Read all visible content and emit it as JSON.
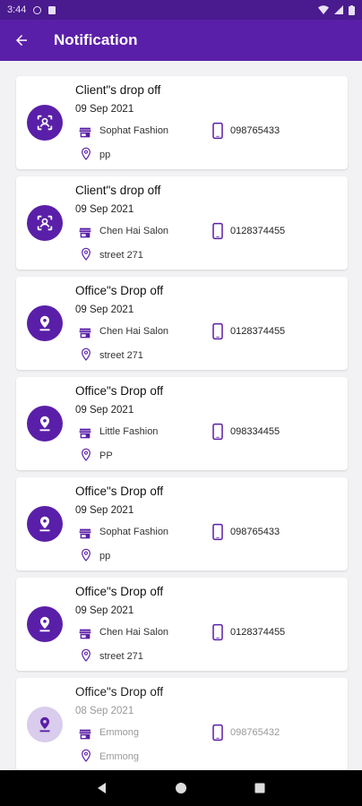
{
  "status_bar": {
    "time": "3:44"
  },
  "header": {
    "title": "Notification"
  },
  "colors": {
    "primary": "#5a1fa8",
    "status_bar": "#4a1a8f",
    "faded_avatar": "#d9ccec"
  },
  "icons": {
    "back": "arrow-left",
    "client": "face-scan",
    "office": "location-pin",
    "shop": "store",
    "phone": "smartphone",
    "location": "map-marker"
  },
  "notifications": [
    {
      "title": "Client\"s drop off",
      "date": "09 Sep 2021",
      "shop": "Sophat Fashion",
      "phone": "098765433",
      "location": "pp"
    },
    {
      "title": "Client\"s drop off",
      "date": "09 Sep 2021",
      "shop": "Chen Hai Salon",
      "phone": "0128374455",
      "location": "street 271"
    },
    {
      "title": "Office\"s Drop off",
      "date": "09 Sep 2021",
      "shop": "Chen Hai Salon",
      "phone": "0128374455",
      "location": "street 271"
    },
    {
      "title": "Office\"s Drop off",
      "date": "09 Sep 2021",
      "shop": "Little Fashion",
      "phone": "098334455",
      "location": "PP"
    },
    {
      "title": "Office\"s Drop off",
      "date": "09 Sep 2021",
      "shop": "Sophat Fashion",
      "phone": "098765433",
      "location": "pp"
    },
    {
      "title": "Office\"s Drop off",
      "date": "09 Sep 2021",
      "shop": "Chen Hai Salon",
      "phone": "0128374455",
      "location": "street 271"
    },
    {
      "title": "Office\"s Drop off",
      "date": "08 Sep 2021",
      "shop": "Emmong",
      "phone": "098765432",
      "location": "Emmong"
    }
  ]
}
